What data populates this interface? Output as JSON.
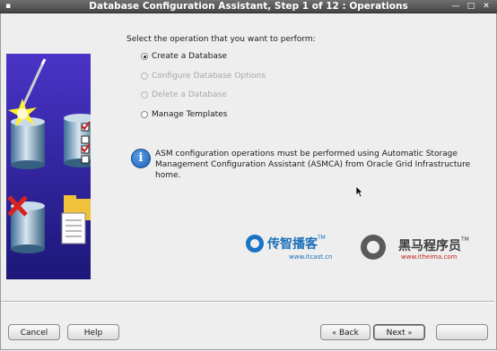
{
  "window": {
    "title": "Database Configuration Assistant, Step 1 of 12 : Operations",
    "min_glyph": "—",
    "max_glyph": "□",
    "close_glyph": "✕"
  },
  "main": {
    "heading": "Select the operation that you want to perform:",
    "options": [
      {
        "label": "Create a Database",
        "selected": true,
        "enabled": true
      },
      {
        "label": "Configure Database Options",
        "selected": false,
        "enabled": false
      },
      {
        "label": "Delete a Database",
        "selected": false,
        "enabled": false
      },
      {
        "label": "Manage Templates",
        "selected": false,
        "enabled": true
      }
    ],
    "info_icon": "i",
    "info_message_line1": "ASM configuration operations must be performed using Automatic Storage",
    "info_message_line2": "Management Configuration Assistant (ASMCA) from Oracle Grid Infrastructure home."
  },
  "watermarks": {
    "left_title": "传智播客",
    "left_tm": "TM",
    "left_url": "www.itcast.cn",
    "right_title": "黑马程序员",
    "right_tm": "TM",
    "right_url": "www.itheima.com"
  },
  "footer": {
    "cancel_label": "Cancel",
    "help_label": "Help",
    "back_arrow": "«",
    "back_label": "Back",
    "next_label": "Next",
    "next_arrow": "»",
    "finish_label": ""
  },
  "colors": {
    "accent_blue": "#1a74c4",
    "watermark_red": "#c22222",
    "titlebar": "#454545"
  },
  "icons": {
    "info": "info-icon",
    "side_image": "database-wizard-illustration"
  }
}
